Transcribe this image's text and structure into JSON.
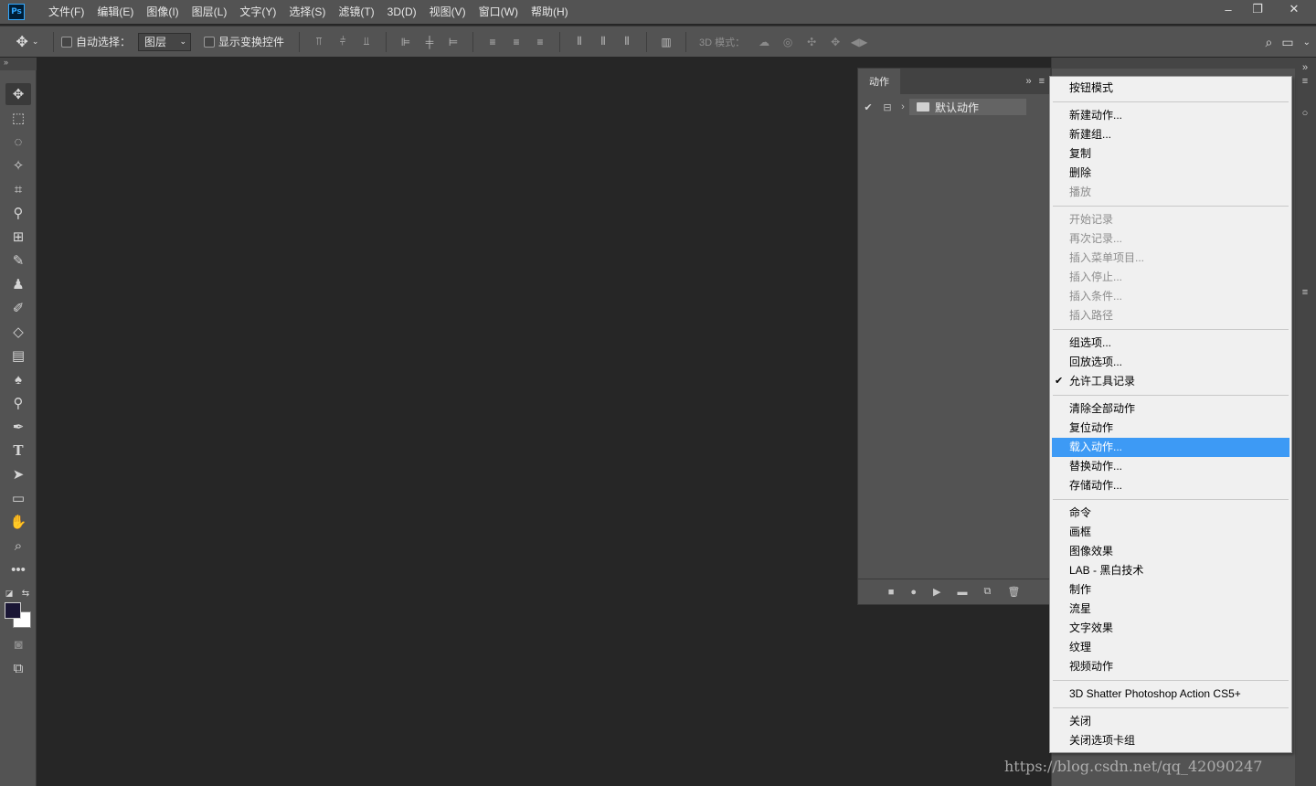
{
  "app": {
    "logo_text": "Ps",
    "menus": [
      "文件(F)",
      "编辑(E)",
      "图像(I)",
      "图层(L)",
      "文字(Y)",
      "选择(S)",
      "滤镜(T)",
      "3D(D)",
      "视图(V)",
      "窗口(W)",
      "帮助(H)"
    ],
    "window_controls": {
      "minimize": "–",
      "restore": "❐",
      "close": "✕"
    }
  },
  "options_bar": {
    "auto_select_label": "自动选择：",
    "auto_select_value": "图层",
    "show_transform_label": "显示变换控件",
    "mode_3d_label": "3D 模式："
  },
  "actions_panel": {
    "tab_label": "动作",
    "set_name": "默认动作"
  },
  "context_menu": {
    "groups": [
      [
        {
          "label": "按钮模式",
          "enabled": true
        }
      ],
      [
        {
          "label": "新建动作...",
          "enabled": true
        },
        {
          "label": "新建组...",
          "enabled": true
        },
        {
          "label": "复制",
          "enabled": true
        },
        {
          "label": "删除",
          "enabled": true
        },
        {
          "label": "播放",
          "enabled": false
        }
      ],
      [
        {
          "label": "开始记录",
          "enabled": false
        },
        {
          "label": "再次记录...",
          "enabled": false
        },
        {
          "label": "插入菜单项目...",
          "enabled": false
        },
        {
          "label": "插入停止...",
          "enabled": false
        },
        {
          "label": "插入条件...",
          "enabled": false
        },
        {
          "label": "插入路径",
          "enabled": false
        }
      ],
      [
        {
          "label": "组选项...",
          "enabled": true
        },
        {
          "label": "回放选项...",
          "enabled": true
        },
        {
          "label": "允许工具记录",
          "enabled": true,
          "checked": true
        }
      ],
      [
        {
          "label": "清除全部动作",
          "enabled": true
        },
        {
          "label": "复位动作",
          "enabled": true
        },
        {
          "label": "载入动作...",
          "enabled": true,
          "highlighted": true
        },
        {
          "label": "替换动作...",
          "enabled": true
        },
        {
          "label": "存储动作...",
          "enabled": true
        }
      ],
      [
        {
          "label": "命令",
          "enabled": true
        },
        {
          "label": "画框",
          "enabled": true
        },
        {
          "label": "图像效果",
          "enabled": true
        },
        {
          "label": "LAB - 黑白技术",
          "enabled": true
        },
        {
          "label": "制作",
          "enabled": true
        },
        {
          "label": "流星",
          "enabled": true
        },
        {
          "label": "文字效果",
          "enabled": true
        },
        {
          "label": "纹理",
          "enabled": true
        },
        {
          "label": "视频动作",
          "enabled": true
        }
      ],
      [
        {
          "label": "3D Shatter Photoshop Action CS5+",
          "enabled": true
        }
      ],
      [
        {
          "label": "关闭",
          "enabled": true
        },
        {
          "label": "关闭选项卡组",
          "enabled": true
        }
      ]
    ]
  },
  "watermark": "https://blog.csdn.net/qq_42090247",
  "colors": {
    "foreground": "#1a1635",
    "background": "#ffffff",
    "highlight": "#3d9af5"
  }
}
